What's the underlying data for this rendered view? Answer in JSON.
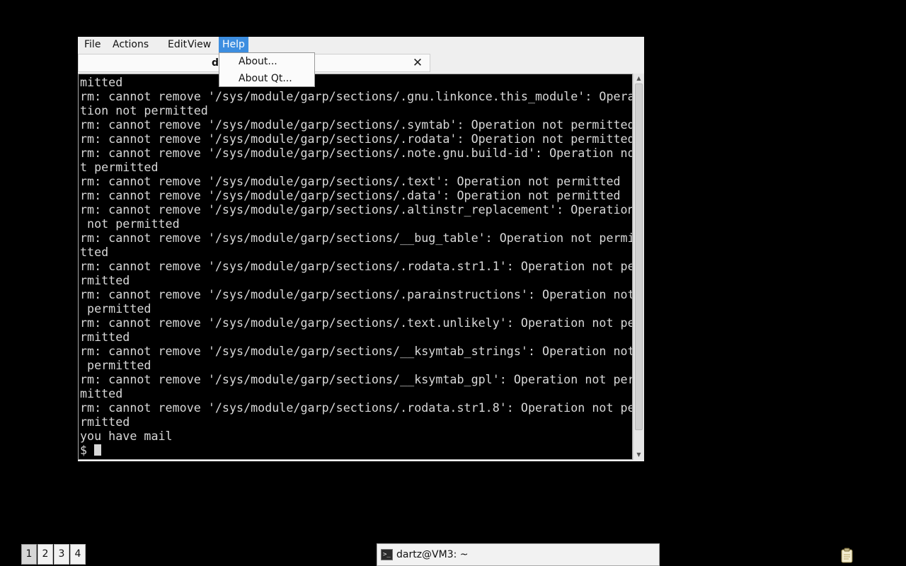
{
  "menubar": {
    "items": [
      {
        "label": "File"
      },
      {
        "label": "Actions"
      },
      {
        "label": "Edit"
      },
      {
        "label": "View"
      },
      {
        "label": "Help"
      }
    ]
  },
  "tab": {
    "label": "d",
    "close_icon": "close-icon"
  },
  "help_menu": {
    "items": [
      {
        "label": "About..."
      },
      {
        "label": "About Qt..."
      }
    ]
  },
  "terminal": {
    "lines": [
      "mitted",
      "rm: cannot remove '/sys/module/garp/sections/.gnu.linkonce.this_module': Opera",
      "tion not permitted",
      "rm: cannot remove '/sys/module/garp/sections/.symtab': Operation not permitted",
      "rm: cannot remove '/sys/module/garp/sections/.rodata': Operation not permitted",
      "rm: cannot remove '/sys/module/garp/sections/.note.gnu.build-id': Operation no",
      "t permitted",
      "rm: cannot remove '/sys/module/garp/sections/.text': Operation not permitted",
      "rm: cannot remove '/sys/module/garp/sections/.data': Operation not permitted",
      "rm: cannot remove '/sys/module/garp/sections/.altinstr_replacement': Operation",
      " not permitted",
      "rm: cannot remove '/sys/module/garp/sections/__bug_table': Operation not permi",
      "tted",
      "rm: cannot remove '/sys/module/garp/sections/.rodata.str1.1': Operation not pe",
      "rmitted",
      "rm: cannot remove '/sys/module/garp/sections/.parainstructions': Operation not",
      " permitted",
      "rm: cannot remove '/sys/module/garp/sections/.text.unlikely': Operation not pe",
      "rmitted",
      "rm: cannot remove '/sys/module/garp/sections/__ksymtab_strings': Operation not",
      " permitted",
      "rm: cannot remove '/sys/module/garp/sections/__ksymtab_gpl': Operation not per",
      "mitted",
      "rm: cannot remove '/sys/module/garp/sections/.rodata.str1.8': Operation not pe",
      "rmitted",
      "you have mail"
    ],
    "prompt": "$ "
  },
  "panel": {
    "workspaces": [
      "1",
      "2",
      "3",
      "4"
    ],
    "active_workspace": "1",
    "task": {
      "label": "dartz@VM3: ~",
      "icon": "terminal-icon"
    },
    "tray_icon": "clipboard-icon"
  }
}
